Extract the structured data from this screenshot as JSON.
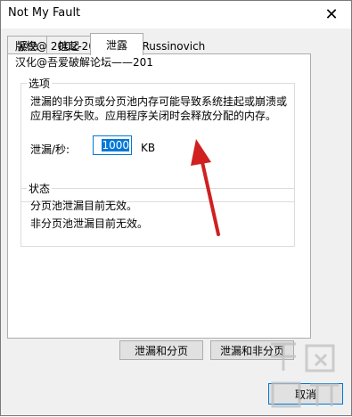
{
  "window": {
    "title": "Not My Fault",
    "close_glyph": "✕"
  },
  "tabs": [
    {
      "label": "紧急",
      "active": false
    },
    {
      "label": "挂起",
      "active": false
    },
    {
      "label": "泄露",
      "active": true
    }
  ],
  "header": {
    "copyright_line1": "版权@ 2002-2016 Mark Russinovich",
    "copyright_line2": "汉化@吾爱破解论坛——201"
  },
  "options": {
    "title": "选项",
    "description": "泄漏的非分页或分页池内存可能导致系统挂起或崩溃或应用程序失败。应用程序关闭时会释放分配的内存。",
    "leak_label": "泄漏/秒:",
    "leak_value": "1000",
    "leak_unit": "KB"
  },
  "status": {
    "title": "状态",
    "line1": "分页池泄漏目前无效。",
    "line2": "非分页池泄漏目前无效。"
  },
  "buttons": {
    "leak_paged": "泄漏和分页",
    "leak_nonpaged": "泄漏和非分页",
    "cancel": "取消"
  },
  "colors": {
    "arrow": "#d02020",
    "accent": "#0078d7"
  },
  "icons": {
    "close": "close-icon",
    "annotation": "red-arrow-annotation"
  }
}
